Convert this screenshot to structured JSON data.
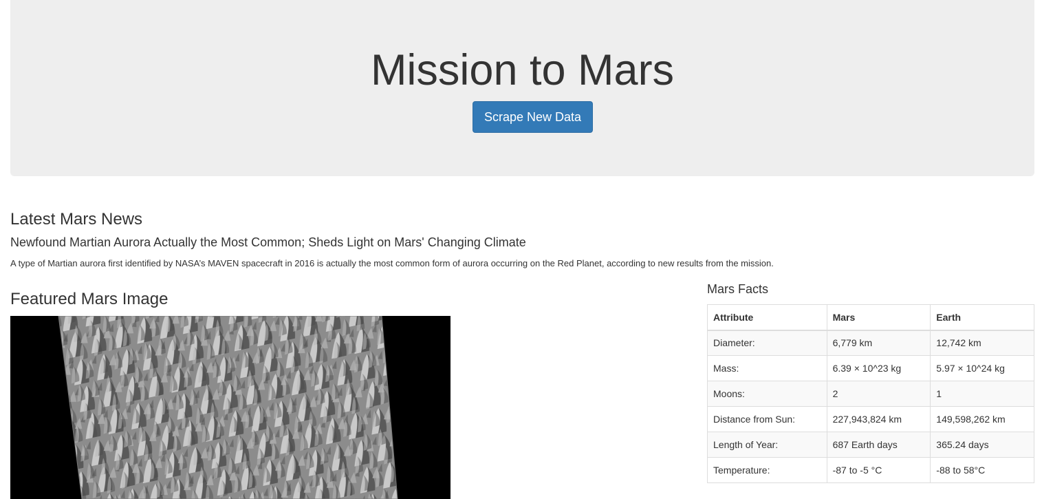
{
  "header": {
    "title": "Mission to Mars",
    "scrape_button_label": "Scrape New Data"
  },
  "news": {
    "heading": "Latest Mars News",
    "title": "Newfound Martian Aurora Actually the Most Common; Sheds Light on Mars' Changing Climate",
    "body": "A type of Martian aurora first identified by NASA’s MAVEN spacecraft in 2016 is actually the most common form of aurora occurring on the Red Planet, according to new results from the mission."
  },
  "featured": {
    "heading": "Featured Mars Image"
  },
  "facts": {
    "heading": "Mars Facts",
    "columns": [
      "Attribute",
      "Mars",
      "Earth"
    ],
    "rows": [
      [
        "Diameter:",
        "6,779 km",
        "12,742 km"
      ],
      [
        "Mass:",
        "6.39 × 10^23 kg",
        "5.97 × 10^24 kg"
      ],
      [
        "Moons:",
        "2",
        "1"
      ],
      [
        "Distance from Sun:",
        "227,943,824 km",
        "149,598,262 km"
      ],
      [
        "Length of Year:",
        "687 Earth days",
        "365.24 days"
      ],
      [
        "Temperature:",
        "-87 to -5 °C",
        "-88 to 58°C"
      ]
    ]
  }
}
